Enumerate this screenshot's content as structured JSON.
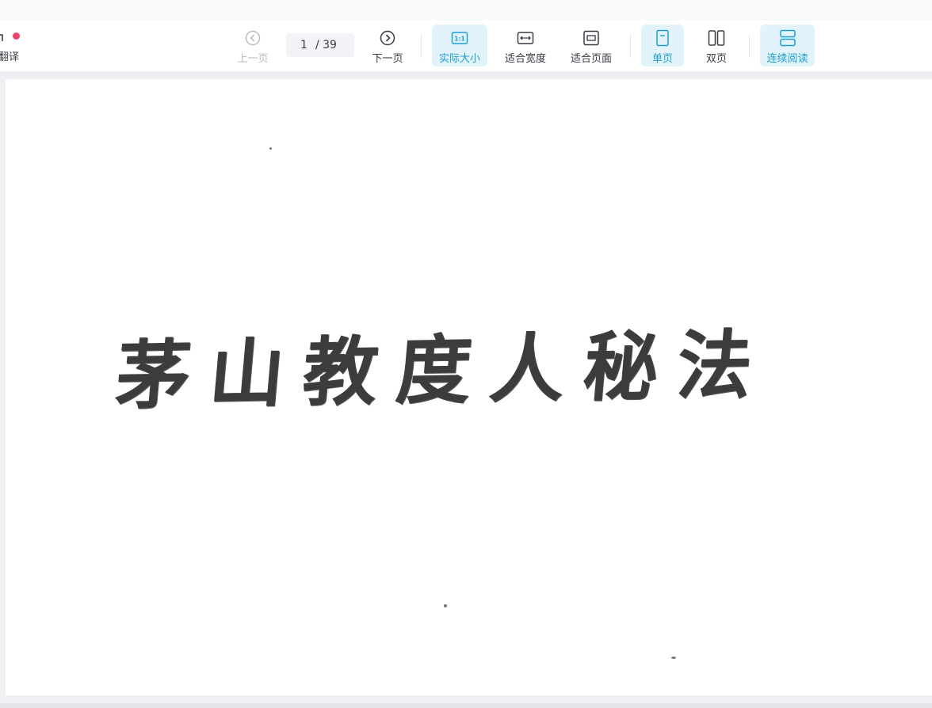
{
  "toolbar": {
    "translate_label": "翻译",
    "prev_label": "上一页",
    "current_page": "1",
    "total_pages": "/ 39",
    "next_label": "下一页",
    "actual_size_label": "实际大小",
    "fit_width_label": "适合宽度",
    "fit_page_label": "适合页面",
    "single_page_label": "单页",
    "double_page_label": "双页",
    "continuous_label": "连续阅读"
  },
  "document": {
    "title_text": "茅山教度人秘法"
  },
  "colors": {
    "accent": "#1aa0d6",
    "active_bg": "#e3f3fb",
    "badge": "#f0446a"
  },
  "icons": [
    "translate-icon",
    "prev-page-icon",
    "next-page-icon",
    "actual-size-icon",
    "fit-width-icon",
    "fit-page-icon",
    "single-page-icon",
    "double-page-icon",
    "continuous-icon"
  ]
}
